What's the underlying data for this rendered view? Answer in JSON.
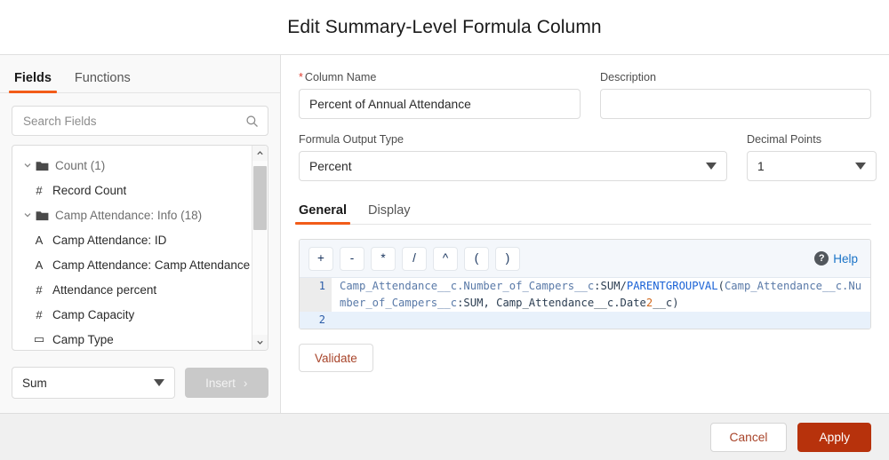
{
  "header": {
    "title": "Edit Summary-Level Formula Column"
  },
  "left_panel": {
    "tabs": [
      {
        "label": "Fields",
        "active": true
      },
      {
        "label": "Functions",
        "active": false
      }
    ],
    "search": {
      "placeholder": "Search Fields",
      "value": "",
      "icon": "search-icon"
    },
    "tree": [
      {
        "kind": "group",
        "label": "Count (1)",
        "expanded": true,
        "icon": "folder-icon"
      },
      {
        "kind": "leaf",
        "label": "Record Count",
        "type_icon": "#"
      },
      {
        "kind": "group",
        "label": "Camp Attendance: Info (18)",
        "expanded": true,
        "icon": "folder-icon"
      },
      {
        "kind": "leaf",
        "label": "Camp Attendance: ID",
        "type_icon": "A"
      },
      {
        "kind": "leaf",
        "label": "Camp Attendance: Camp Attendance I",
        "type_icon": "A"
      },
      {
        "kind": "leaf",
        "label": "Attendance percent",
        "type_icon": "#"
      },
      {
        "kind": "leaf",
        "label": "Camp Capacity",
        "type_icon": "#"
      },
      {
        "kind": "leaf",
        "label": "Camp Type",
        "type_icon": "▭"
      }
    ],
    "scrollbar": {
      "up_icon": "chevron-up-icon",
      "down_icon": "chevron-down-icon"
    },
    "aggregate_select": {
      "value": "Sum",
      "caret_icon": "caret-down-icon"
    },
    "insert_button": {
      "label": "Insert",
      "chevron": "›",
      "disabled": true
    }
  },
  "form": {
    "column_name": {
      "label": "Column Name",
      "required_marker": "*",
      "value": "Percent of Annual Attendance",
      "placeholder": ""
    },
    "description": {
      "label": "Description",
      "value": "",
      "placeholder": ""
    },
    "formula_output_type": {
      "label": "Formula Output Type",
      "value": "Percent",
      "caret_icon": "caret-down-icon"
    },
    "decimal_points": {
      "label": "Decimal Points",
      "value": "1",
      "caret_icon": "caret-down-icon"
    }
  },
  "section_tabs": [
    {
      "label": "General",
      "active": true
    },
    {
      "label": "Display",
      "active": false
    }
  ],
  "editor": {
    "operators": [
      "+",
      "-",
      "*",
      "/",
      "^",
      "(",
      ")"
    ],
    "help": {
      "label": "Help",
      "icon": "question-mark-icon",
      "badge": "?"
    },
    "lines": [
      {
        "number": "1",
        "current": false,
        "tokens": [
          {
            "text": "Camp_Attendance__c.Number_of_Campers__c",
            "cls": "tok-id"
          },
          {
            "text": ":",
            "cls": "tok-punc"
          },
          {
            "text": "SUM",
            "cls": "tok-kw"
          },
          {
            "text": "/",
            "cls": "tok-punc"
          },
          {
            "text": "PARENTGROUPVAL",
            "cls": "tok-fn"
          },
          {
            "text": "(",
            "cls": "tok-punc"
          },
          {
            "text": "Camp_Attendance__c.Number_of_Campers__c",
            "cls": "tok-id"
          },
          {
            "text": ":",
            "cls": "tok-punc"
          },
          {
            "text": "SUM",
            "cls": "tok-kw"
          },
          {
            "text": ", ",
            "cls": "tok-punc"
          },
          {
            "text": "Camp_Attendance__c.Date",
            "cls": "tok-kw"
          },
          {
            "text": "2",
            "cls": "tok-num"
          },
          {
            "text": "__c",
            "cls": "tok-kw"
          },
          {
            "text": ")",
            "cls": "tok-punc"
          }
        ]
      },
      {
        "number": "2",
        "current": true,
        "tokens": []
      }
    ],
    "validate_button": {
      "label": "Validate"
    }
  },
  "footer": {
    "cancel_label": "Cancel",
    "apply_label": "Apply"
  },
  "colors": {
    "accent_orange": "#f25c19",
    "primary_red": "#b7320c",
    "link_blue": "#1a73c7",
    "required_red": "#e0392c",
    "code_keyword_blue": "#1a62d6",
    "code_number_orange": "#d2691e"
  }
}
